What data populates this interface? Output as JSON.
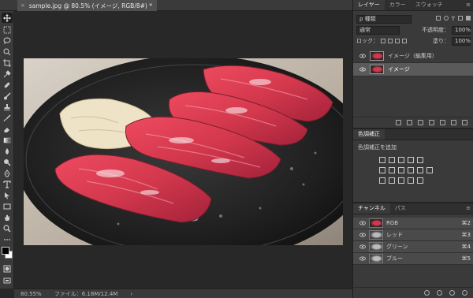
{
  "document": {
    "tab_title": "sample.jpg @ 80.5% (イメージ, RGB/8#) *",
    "close_glyph": "×"
  },
  "status": {
    "zoom": "80.55%",
    "file_info": "ファイル：6.18M/12.4M",
    "arrow": "›"
  },
  "layers_panel": {
    "tabs": [
      "レイヤー",
      "カラー",
      "スウォッチ"
    ],
    "menu": "≡",
    "filter": "ρ 種類",
    "blend_mode": "通常",
    "opacity_label": "不透明度：",
    "opacity_value": "100%",
    "lock_label": "ロック：",
    "fill_label": "塗り：",
    "fill_value": "100%",
    "layers": [
      {
        "name": "イメージ（編集用）",
        "visible": true,
        "selected": false
      },
      {
        "name": "イメージ",
        "visible": true,
        "selected": true
      }
    ]
  },
  "adjustments_panel": {
    "tab": "色調補正",
    "label": "色調補正を追加"
  },
  "channels_panel": {
    "tabs": [
      "チャンネル",
      "パス"
    ],
    "menu": "≡",
    "channels": [
      {
        "name": "RGB",
        "shortcut": "⌘2"
      },
      {
        "name": "レッド",
        "shortcut": "⌘3"
      },
      {
        "name": "グリーン",
        "shortcut": "⌘4"
      },
      {
        "name": "ブルー",
        "shortcut": "⌘5"
      }
    ]
  },
  "tools": [
    "move-icon",
    "marquee-icon",
    "lasso-icon",
    "quick-select-icon",
    "crop-icon",
    "eyedropper-icon",
    "healing-icon",
    "brush-icon",
    "clone-stamp-icon",
    "history-brush-icon",
    "eraser-icon",
    "gradient-icon",
    "blur-icon",
    "dodge-icon",
    "pen-icon",
    "type-icon",
    "path-select-icon",
    "rectangle-icon",
    "hand-icon",
    "zoom-icon",
    "more-icon"
  ],
  "colors": {
    "accent_red": "#d3384d",
    "panel_bg": "#3a3a3a",
    "canvas_bg": "#282828"
  }
}
